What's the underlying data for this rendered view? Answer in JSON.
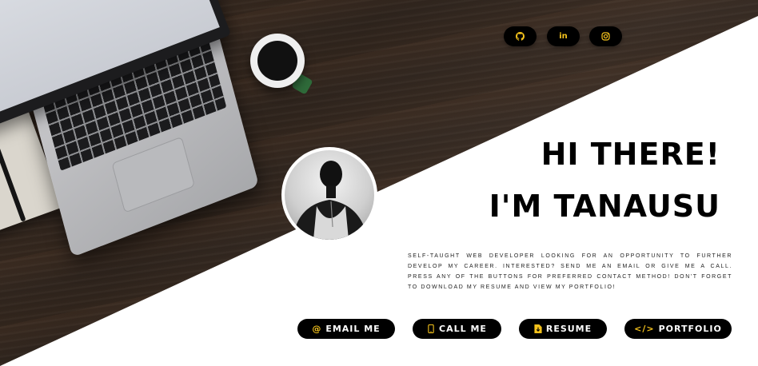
{
  "social": [
    {
      "name": "github",
      "icon": "github-icon"
    },
    {
      "name": "linkedin",
      "icon": "linkedin-icon",
      "glyph": "in"
    },
    {
      "name": "instagram",
      "icon": "instagram-icon"
    }
  ],
  "hero": {
    "line1": "HI THERE!",
    "line2": "I'M TANAUSU",
    "intro": "SELF-TAUGHT WEB DEVELOPER LOOKING FOR AN OPPORTUNITY TO FURTHER DEVELOP MY CAREER. INTERESTED? SEND ME AN EMAIL OR GIVE ME A CALL. PRESS ANY OF THE BUTTONS FOR PREFERRED CONTACT METHOD! DON'T FORGET TO DOWNLOAD MY RESUME AND VIEW MY PORTFOLIO!"
  },
  "actions": {
    "email": {
      "label": "EMAIL ME",
      "glyph": "@",
      "icon": "at-icon"
    },
    "call": {
      "label": "CALL ME",
      "icon": "phone-icon"
    },
    "resume": {
      "label": "RESUME",
      "icon": "file-download-icon"
    },
    "portfolio": {
      "label": "PORTFOLIO",
      "glyph": "</>",
      "icon": "code-icon"
    }
  },
  "colors": {
    "accent": "#f4c21c",
    "button_bg": "#000000",
    "button_text": "#ffffff",
    "heading": "#000000"
  }
}
